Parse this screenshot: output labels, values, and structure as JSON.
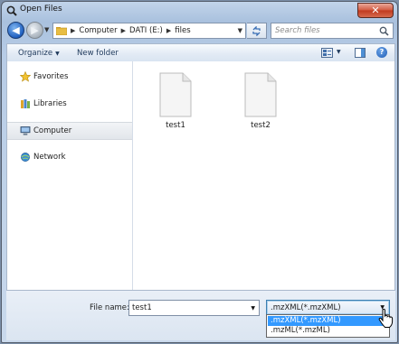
{
  "window": {
    "title": "Open Files"
  },
  "address": {
    "crumbs": [
      "Computer",
      "DATI (E:)",
      "files"
    ],
    "search_placeholder": "Search files"
  },
  "toolbar": {
    "organize_label": "Organize",
    "new_folder_label": "New folder"
  },
  "navigation": {
    "items": [
      {
        "label": "Favorites",
        "icon": "star-icon"
      },
      {
        "label": "Libraries",
        "icon": "library-icon"
      },
      {
        "label": "Computer",
        "icon": "computer-icon",
        "selected": true
      },
      {
        "label": "Network",
        "icon": "network-icon"
      }
    ]
  },
  "files": [
    {
      "name": "test1",
      "icon": "document-icon"
    },
    {
      "name": "test2",
      "icon": "document-icon"
    }
  ],
  "file_name": {
    "label": "File name:",
    "value": "test1"
  },
  "file_type": {
    "selected": ".mzXML(*.mzXML)",
    "options": [
      ".mzXML(*.mzXML)",
      ".mzML(*.mzML)"
    ],
    "highlighted_index": 0
  },
  "colors": {
    "selection": "#3399ff",
    "close_button": "#c0391e",
    "chrome": "#b7cce6"
  }
}
